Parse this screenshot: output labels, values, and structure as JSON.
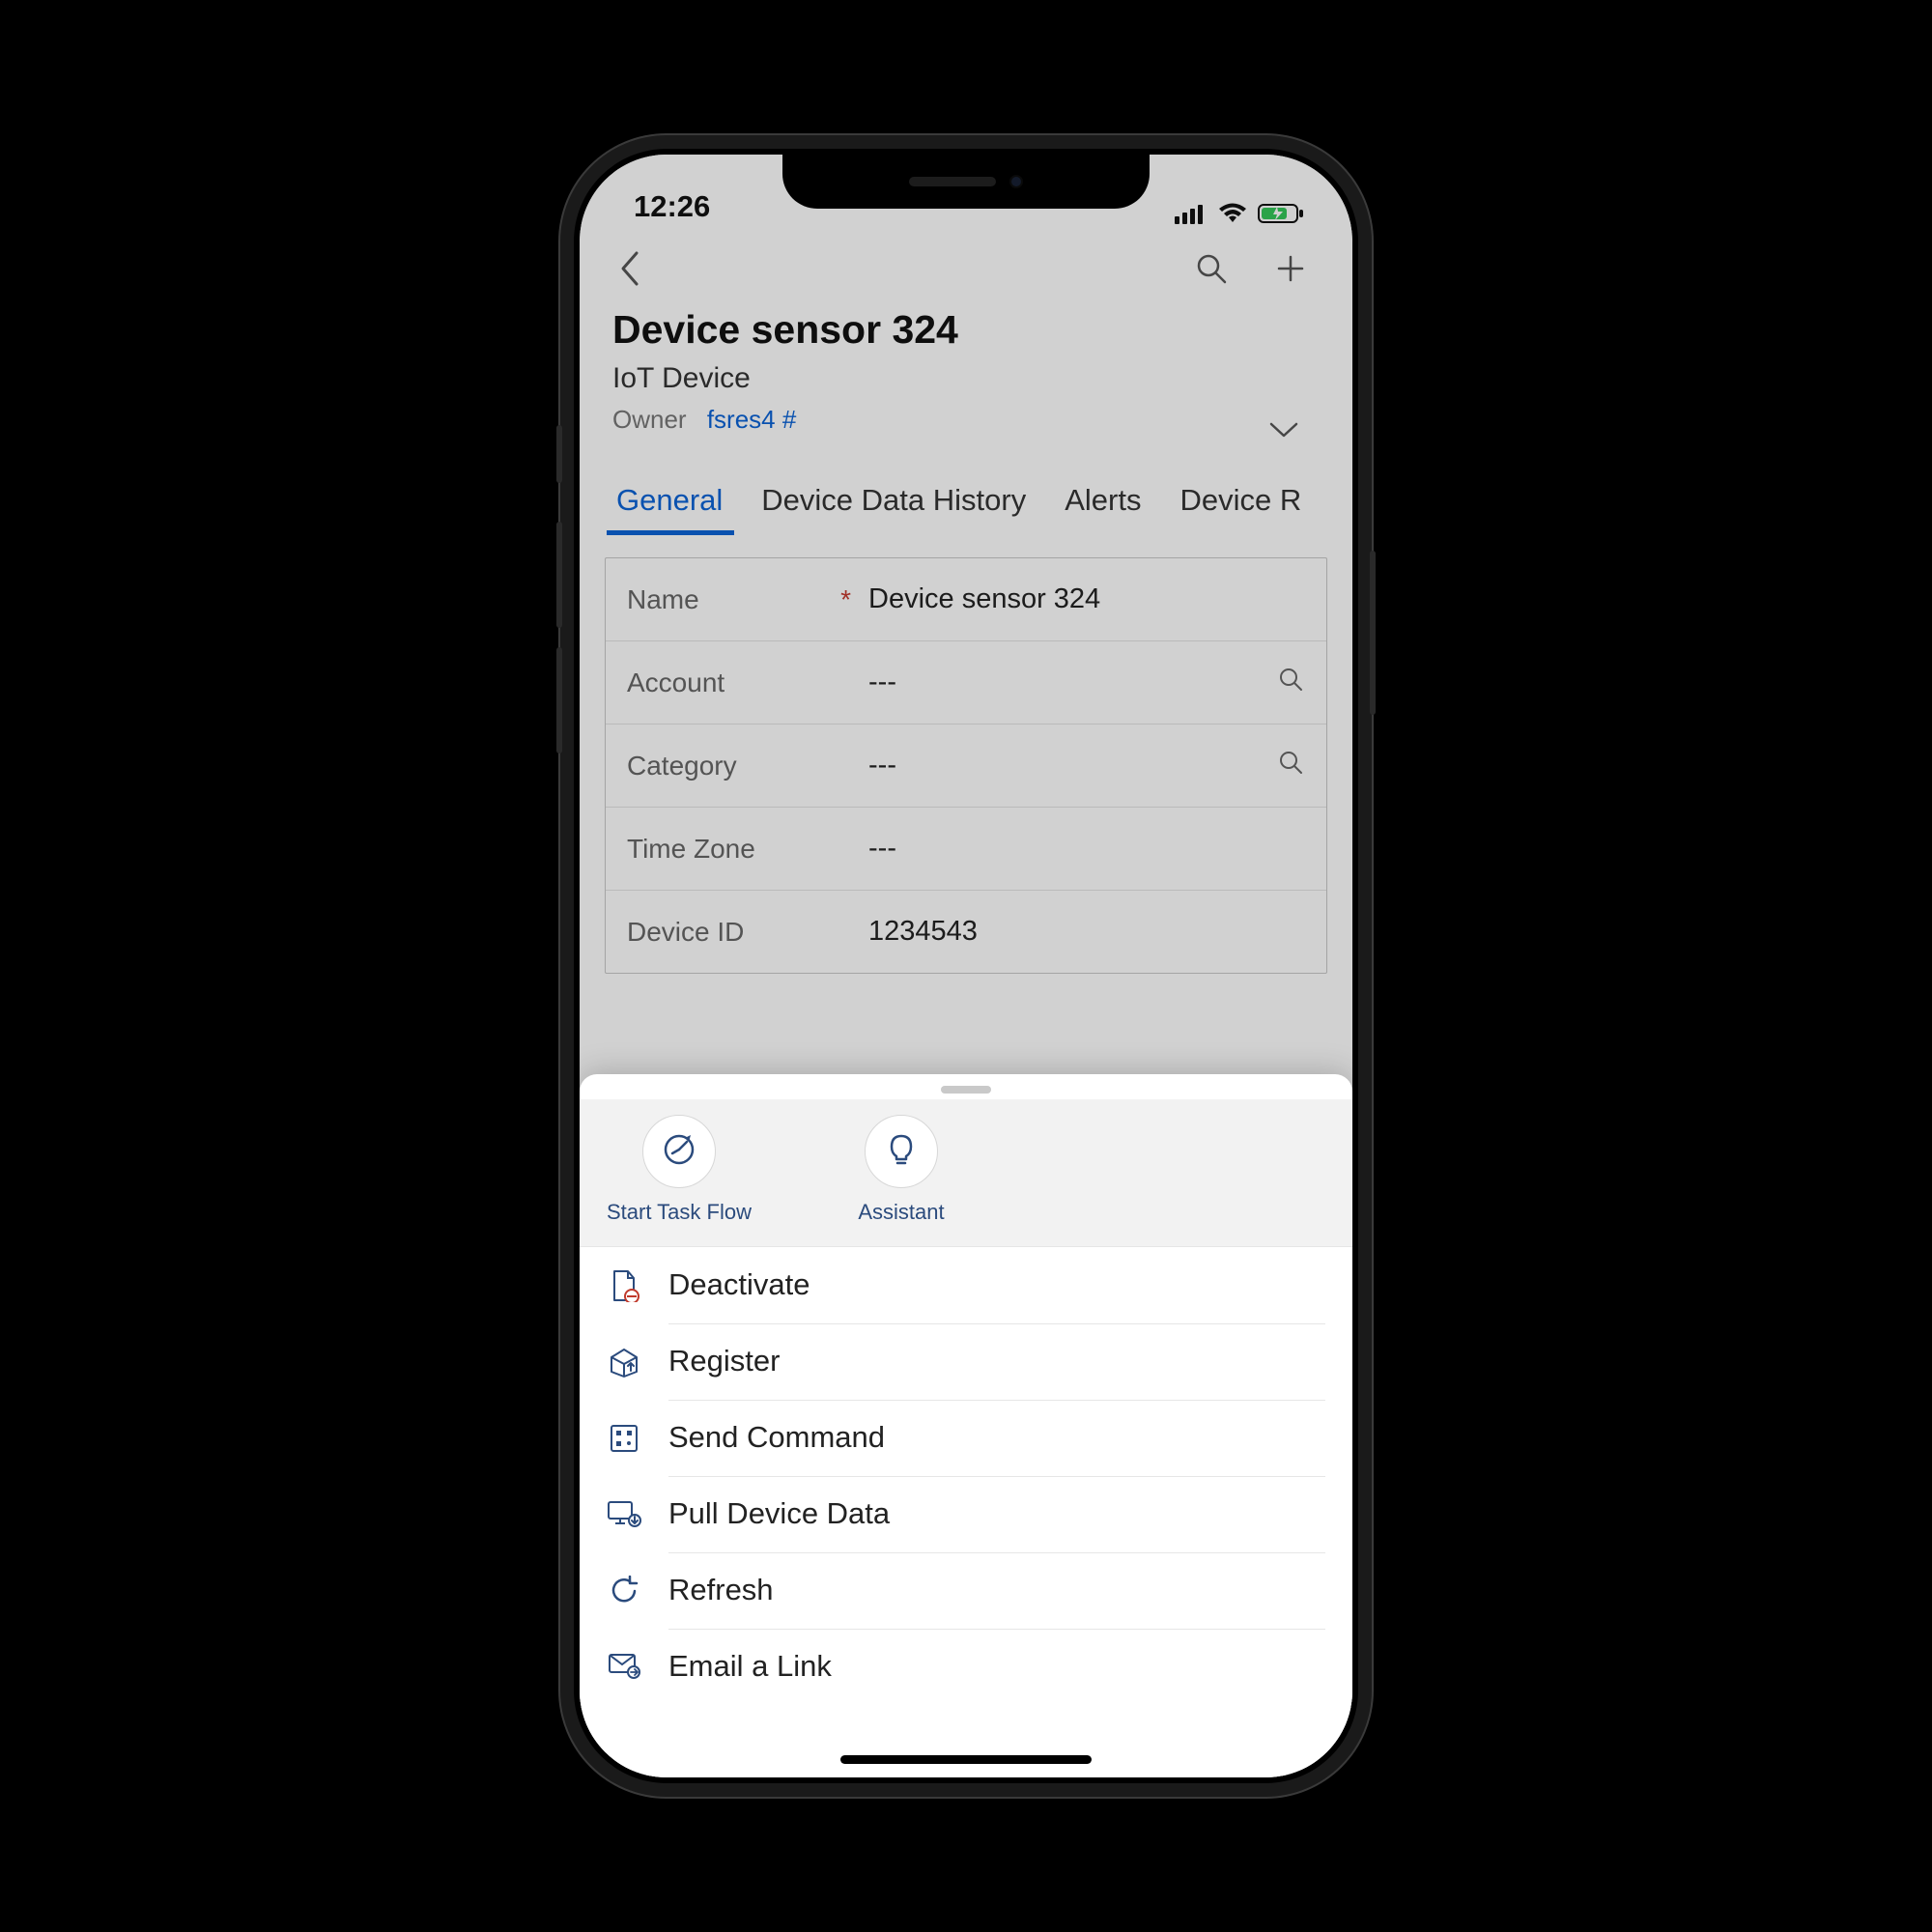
{
  "status": {
    "time": "12:26"
  },
  "header": {
    "title": "Device sensor 324",
    "subtitle": "IoT Device",
    "owner_label": "Owner",
    "owner_value": "fsres4 #"
  },
  "tabs": [
    "General",
    "Device Data History",
    "Alerts",
    "Device R"
  ],
  "form": {
    "rows": [
      {
        "label": "Name",
        "value": "Device sensor 324",
        "required": true,
        "search": false
      },
      {
        "label": "Account",
        "value": "---",
        "required": false,
        "search": true
      },
      {
        "label": "Category",
        "value": "---",
        "required": false,
        "search": true
      },
      {
        "label": "Time Zone",
        "value": "---",
        "required": false,
        "search": false
      },
      {
        "label": "Device ID",
        "value": "1234543",
        "required": false,
        "search": false
      }
    ]
  },
  "sheet": {
    "quick_actions": [
      {
        "label": "Start Task Flow",
        "icon": "gauge"
      },
      {
        "label": "Assistant",
        "icon": "bulb"
      }
    ],
    "items": [
      {
        "label": "Deactivate",
        "icon": "deactivate"
      },
      {
        "label": "Register",
        "icon": "register"
      },
      {
        "label": "Send Command",
        "icon": "command"
      },
      {
        "label": "Pull Device Data",
        "icon": "pull"
      },
      {
        "label": "Refresh",
        "icon": "refresh"
      },
      {
        "label": "Email a Link",
        "icon": "email"
      }
    ]
  },
  "empty": "---",
  "asterisk": "*"
}
